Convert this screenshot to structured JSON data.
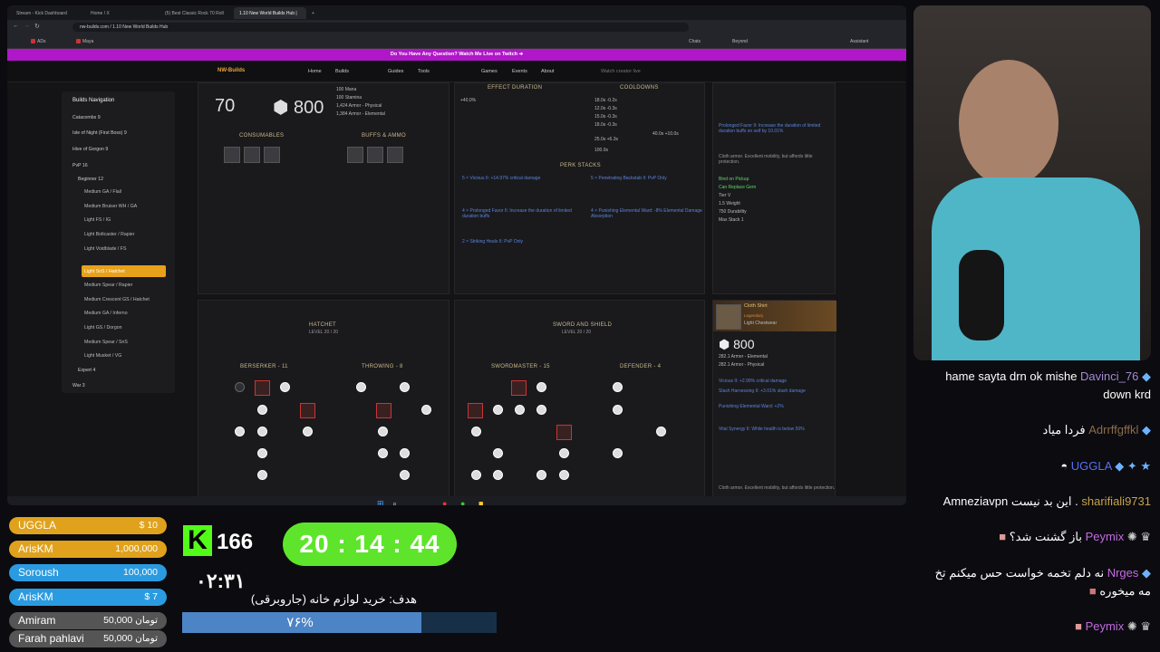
{
  "browser": {
    "tabs": [
      "Stream - Kick Dashboard",
      "Home / X",
      "(5) Best Classic Rock 70 Roll",
      "1.10 New World Builds Hub |"
    ],
    "url": "nw-builds.com / 1.10 New World Builds Hub",
    "bookmarks": [
      "ADs",
      "Maya",
      "Chats",
      "Beyond",
      "Assistant"
    ]
  },
  "banner": "Do You Have Any Question? Watch Me Live on Twitch ➔",
  "site": {
    "logo": "NW-Builds",
    "nav": [
      "Home",
      "Builds",
      "Guides",
      "Tools",
      "Games",
      "Events",
      "About"
    ],
    "search_placeholder": "Watch creator live"
  },
  "sidenav": {
    "title": "Builds Navigation",
    "items": [
      {
        "label": "Catacombs",
        "count": "9"
      },
      {
        "label": "Isle of Night (First Boss)",
        "count": "9"
      },
      {
        "label": "Hive of Gorgon",
        "count": "9"
      },
      {
        "label": "PvP",
        "count": "16"
      },
      {
        "label": "Beginner",
        "count": "12"
      }
    ],
    "builds": [
      "Medium GA / Flail",
      "Medium Bruiser WH / GA",
      "Light FS / IG",
      "Light Boltcaster / Rapier",
      "Light Voidblade / FS",
      "Light SnS / Hatchet",
      "Medium Spear / Rapier",
      "Medium Crescent GS / Hatchet",
      "Medium GA / Inferno",
      "Light GS / Dorgon",
      "Medium Spear / SnS",
      "Light Musket / VG"
    ],
    "active": "Light SnS / Hatchet",
    "footer": [
      {
        "label": "Expert",
        "count": "4"
      },
      {
        "label": "War",
        "count": "3"
      }
    ]
  },
  "gear": {
    "gear_score": "70",
    "armor": "800",
    "stats": [
      "100 Mana",
      "100 Stamina",
      "1,424 Armor - Physical",
      "1,384 Armor - Elemental"
    ],
    "consumables": "CONSUMABLES",
    "buffs": "BUFFS & AMMO"
  },
  "effects": {
    "effect_title": "EFFECT DURATION",
    "cooldown_title": "COOLDOWNS",
    "effect_val": "+40.0%",
    "cooldowns": [
      "18.0s -0.2s",
      "12.0s -0.3s",
      "15.0s -0.3s",
      "18.0s -0.3s",
      "25.0s +6.3s",
      "100.0s",
      "40.0s +10.0s"
    ],
    "perk_title": "PERK STACKS",
    "perks": [
      "5 × Vicious II: +14.97% critical damage",
      "5 × Penetrating Backstab II: PvP Only",
      "4 × Prolonged Favor II: Increase the duration of limited duration buffs",
      "4 × Punishing Elemental Ward: -8% Elemental Damage Absorption",
      "2 × Striking Heals II: PvP Only"
    ]
  },
  "weapons": [
    {
      "name": "HATCHET",
      "level": "LEVEL 20 / 20",
      "trees": [
        "BERSERKER - 11",
        "THROWING - 8"
      ]
    },
    {
      "name": "SWORD AND SHIELD",
      "level": "LEVEL 20 / 20",
      "trees": [
        "SWORDMASTER - 15",
        "DEFENDER - 4"
      ]
    }
  ],
  "right_panel": {
    "item_name": "Cloth Shirt",
    "item_rarity": "Legendary",
    "item_sub": "Light Chestwear",
    "armor": "800",
    "armor_lines": [
      "282.1 Armor - Elemental",
      "282.1 Armor - Physical"
    ],
    "perks": [
      "Vicious II: +2.99% critical damage",
      "Slash Harnessing II: +3.01% slash damage",
      "Punishing Elemental Ward: +2%",
      "Vital Synergy II: While health is below 50%",
      "Prolonged Favor II: Increase the duration of limited duration buffs on self by 10.01%"
    ],
    "bind": "Bind on Pickup",
    "can_replace": "Can Replace Gem",
    "tier": "Tier V",
    "weight": "1.5 Weight",
    "durability": "750 Durability",
    "max_stack": "Max Stack 1",
    "desc": "Cloth armor. Excellent mobility, but affords little protection."
  },
  "chat": [
    {
      "name": "Davinci_76",
      "text": "hame sayta drn ok mishe",
      "text2": "down krd"
    },
    {
      "name": "Adrrffgffkl",
      "text": "فردا میاد"
    },
    {
      "name": "UGGLA",
      "text": ""
    },
    {
      "name": "sharifiali9731",
      "text": "Amneziavpn این بد نیست ."
    },
    {
      "name": "Peymix",
      "text": "باز گشنت شد؟"
    },
    {
      "name": "Nrges",
      "text": "نه دلم تخمه خواست حس میکنم تخ",
      "text2": "مه میخوره"
    },
    {
      "name": "Peymix",
      "text": ""
    }
  ],
  "donations": [
    {
      "name": "UGGLA",
      "amount": "$ 10",
      "color": "#e0a21c"
    },
    {
      "name": "ArisKM",
      "amount": "1,000,000",
      "color": "#e0a21c"
    },
    {
      "name": "Soroush",
      "amount": "100,000",
      "color": "#2a9be0"
    },
    {
      "name": "ArisKM",
      "amount": "$ 7",
      "color": "#2a9be0"
    },
    {
      "name": "Amiram",
      "amount": "50,000 تومان",
      "color": "#555"
    },
    {
      "name": "Farah pahlavi",
      "amount": "50,000 تومان",
      "color": "#555"
    }
  ],
  "kick": {
    "viewers": "166",
    "small_timer": "۰۲:۳۱"
  },
  "timer": "20 : 14 : 44",
  "goal": {
    "label": "هدف: خرید لوازم خانه (جاروبرقی)",
    "percent_text": "۷۶%",
    "progress": 0.76
  }
}
